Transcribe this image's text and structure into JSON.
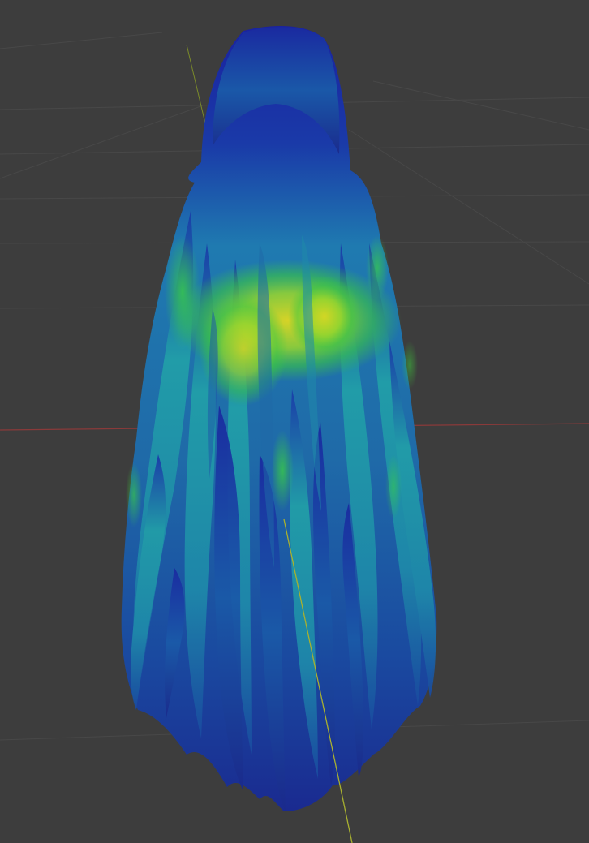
{
  "app": {
    "view": "3d-viewport",
    "shading_mode": "weight-paint"
  },
  "colors": {
    "background": "#3d3d3d",
    "grid_line": "#4a4a4a",
    "x_axis": "#8a3a3a",
    "y_axis": "#8a9a2a",
    "weight_low": "#1a2a9a",
    "weight_mid": "#1f9aa0",
    "weight_green": "#3ccd3a",
    "weight_high": "#d8d820"
  },
  "icons": {
    "object": "hair-mesh-icon"
  }
}
